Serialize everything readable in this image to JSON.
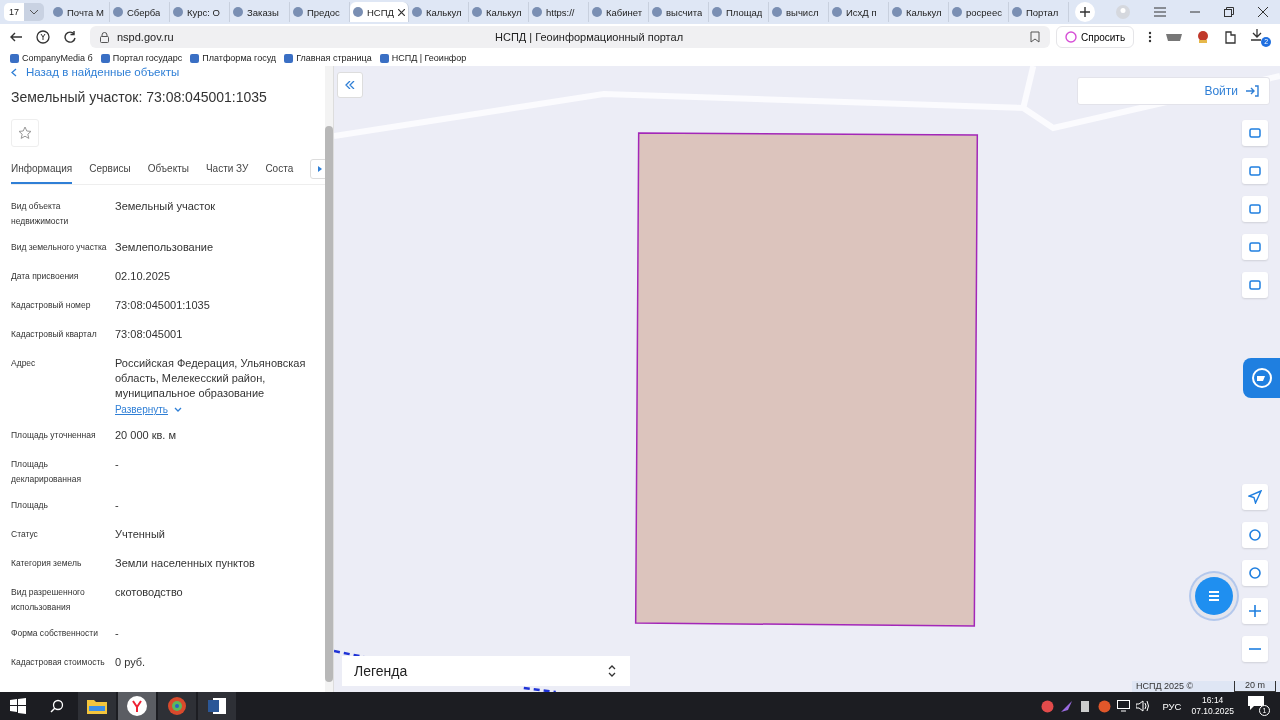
{
  "browser": {
    "tab_count": "17",
    "tabs": [
      {
        "title": "Почта М",
        "selected": false
      },
      {
        "title": "Сберба",
        "selected": false
      },
      {
        "title": "Курс: О",
        "selected": false
      },
      {
        "title": "Заказы",
        "selected": false
      },
      {
        "title": "Предос",
        "selected": false
      },
      {
        "title": "НСПД",
        "selected": true
      },
      {
        "title": "Калькул",
        "selected": false
      },
      {
        "title": "Калькул",
        "selected": false
      },
      {
        "title": "https://",
        "selected": false
      },
      {
        "title": "Кабинет",
        "selected": false
      },
      {
        "title": "высчита",
        "selected": false
      },
      {
        "title": "Площад",
        "selected": false
      },
      {
        "title": "вычисл",
        "selected": false
      },
      {
        "title": "ИсхД п",
        "selected": false
      },
      {
        "title": "Калькул",
        "selected": false
      },
      {
        "title": "росреес",
        "selected": false
      },
      {
        "title": "Портал",
        "selected": false
      }
    ],
    "address": "nspd.gov.ru",
    "page_title": "НСПД | Геоинформационный портал",
    "ask_button": "Спросить",
    "downloads_badge": "2",
    "bookmarks": [
      "CompanyMedia б",
      "Портал государс",
      "Платформа госуд",
      "Главная страница",
      "НСПД | Геоинфор"
    ]
  },
  "panel": {
    "back_link": "Назад в найденные объекты",
    "title": "Земельный участок: 73:08:045001:1035",
    "tabs": [
      {
        "label": "Информация",
        "selected": true
      },
      {
        "label": "Сервисы",
        "selected": false
      },
      {
        "label": "Объекты",
        "selected": false
      },
      {
        "label": "Части ЗУ",
        "selected": false
      },
      {
        "label": "Соста",
        "selected": false
      }
    ],
    "fields": [
      {
        "label": "Вид объекта недвижимости",
        "value": "Земельный участок"
      },
      {
        "label": "Вид земельного участка",
        "value": "Землепользование"
      },
      {
        "label": "Дата присвоения",
        "value": "02.10.2025"
      },
      {
        "label": "Кадастровый номер",
        "value": "73:08:045001:1035"
      },
      {
        "label": "Кадастровый квартал",
        "value": "73:08:045001"
      },
      {
        "label": "Адрес",
        "value": "Российская Федерация, Ульяновская область, Мелекесский район, муниципальное образование",
        "expand_link": "Развернуть"
      },
      {
        "label": "Площадь уточненная",
        "value": "20 000 кв. м"
      },
      {
        "label": "Площадь декларированная",
        "value": "-"
      },
      {
        "label": "Площадь",
        "value": "-"
      },
      {
        "label": "Статус",
        "value": "Учтенный"
      },
      {
        "label": "Категория земель",
        "value": "Земли населенных пунктов"
      },
      {
        "label": "Вид разрешенного использования",
        "value": "скотоводство"
      },
      {
        "label": "Форма собственности",
        "value": "-"
      },
      {
        "label": "Кадастровая стоимость",
        "value": "0 руб."
      }
    ]
  },
  "map": {
    "login_button": "Войти",
    "legend": "Легенда",
    "attribution": "НСПД 2025 ©",
    "scale": "20 m"
  },
  "taskbar": {
    "language": "РУС",
    "time": "16:14",
    "date": "07.10.2025",
    "notifications": "1"
  }
}
